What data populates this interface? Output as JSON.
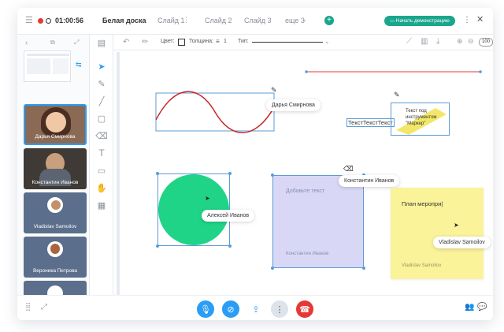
{
  "topbar": {
    "time": "01:00:56",
    "board_title": "Белая доска",
    "tabs": [
      "Слайд 1",
      "Слайд 2",
      "Слайд 3",
      "еще 3"
    ],
    "present_label": "Начать демонстрацию",
    "colors": {
      "accent": "#1aa68c",
      "record": "#e53935"
    }
  },
  "toolbar": {
    "color_label": "Цвет:",
    "thickness_label": "Толщина:",
    "thickness_value": "1",
    "type_label": "Тип:",
    "zoom": "100"
  },
  "sidebar": {
    "participants": [
      {
        "name": "Дарья Смирнова"
      },
      {
        "name": "Константин Иванов"
      },
      {
        "name": "Vladislav Samoilov"
      },
      {
        "name": "Вероника Петрова"
      }
    ]
  },
  "canvas": {
    "cursor_labels": {
      "daria": "Дарья Смирнова",
      "konstantin": "Константин Иванов",
      "aleksey": "Алексей Иванов",
      "vladislav": "Vladislav Samoilov"
    },
    "text_box": "ТекстТекстТекст",
    "marker_note": "Текст под инструментом \"Маркер\"",
    "purple_note": {
      "placeholder": "Добавьте текст",
      "author": "Константин Иванов"
    },
    "yellow_note": {
      "text": "План меропри|",
      "author": "Vladislav Samoilov"
    }
  }
}
